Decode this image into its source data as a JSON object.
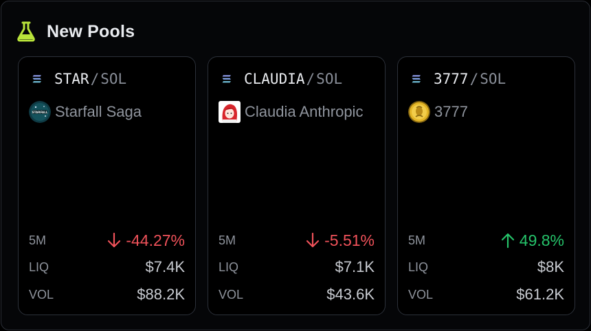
{
  "header": {
    "title": "New Pools",
    "icon": "flask-icon",
    "accent": "#b9e43a"
  },
  "colors": {
    "down": "#f0525a",
    "up": "#25c36a"
  },
  "cards": [
    {
      "base": "STAR",
      "sep": "/",
      "quote": "SOL",
      "name": "Starfall Saga",
      "avatar": "starfall-saga-logo",
      "avatar_text": "STARFALL",
      "stats": {
        "m5_label": "5M",
        "m5_value": "-44.27%",
        "m5_dir": "down",
        "liq_label": "LIQ",
        "liq_value": "$7.4K",
        "vol_label": "VOL",
        "vol_value": "$88.2K"
      }
    },
    {
      "base": "CLAUDIA",
      "sep": "/",
      "quote": "SOL",
      "name": "Claudia Anthropic",
      "avatar": "claudia-avatar",
      "stats": {
        "m5_label": "5M",
        "m5_value": "-5.51%",
        "m5_dir": "down",
        "liq_label": "LIQ",
        "liq_value": "$7.1K",
        "vol_label": "VOL",
        "vol_value": "$43.6K"
      }
    },
    {
      "base": "3777",
      "sep": "/",
      "quote": "SOL",
      "name": "3777",
      "avatar": "gold-coin-avatar",
      "stats": {
        "m5_label": "5M",
        "m5_value": "49.8%",
        "m5_dir": "up",
        "liq_label": "LIQ",
        "liq_value": "$8K",
        "vol_label": "VOL",
        "vol_value": "$61.2K"
      }
    }
  ]
}
